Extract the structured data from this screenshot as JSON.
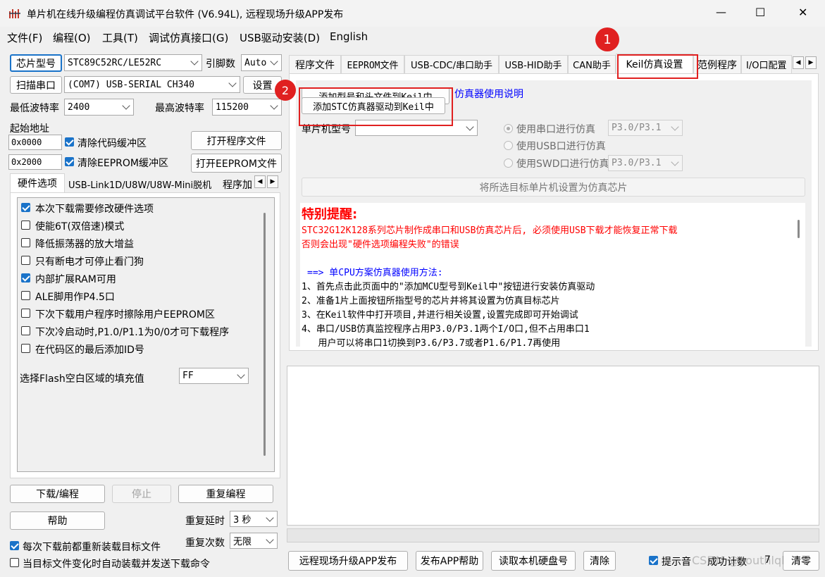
{
  "window": {
    "title": "单片机在线升级编程仿真调试平台软件 (V6.94L), 远程现场升级APP发布",
    "minimize": "—",
    "maximize": "☐",
    "close": "✕"
  },
  "menu": [
    "文件(F)",
    "编程(O)",
    "工具(T)",
    "调试仿真接口(G)",
    "USB驱动安装(D)",
    "English"
  ],
  "left": {
    "chip_button": "芯片型号",
    "chip_value": "STC89C52RC/LE52RC",
    "pin_label": "引脚数",
    "pin_value": "Auto",
    "scan_button": "扫描串口",
    "port_value": "(COM7) USB-SERIAL CH340",
    "settings_button": "设置",
    "min_baud_label": "最低波特率",
    "min_baud_value": "2400",
    "max_baud_label": "最高波特率",
    "max_baud_value": "115200",
    "start_addr_label": "起始地址",
    "addr1": "0x0000",
    "clear_code": "清除代码缓冲区",
    "open_prog": "打开程序文件",
    "addr2": "0x2000",
    "clear_eeprom": "清除EEPROM缓冲区",
    "open_eeprom": "打开EEPROM文件",
    "tabs": [
      "硬件选项",
      "USB-Link1D/U8W/U8W-Mini脱机",
      "程序加"
    ],
    "options": [
      {
        "label": "本次下载需要修改硬件选项",
        "checked": true
      },
      {
        "label": "使能6T(双倍速)模式",
        "checked": false
      },
      {
        "label": "降低振荡器的放大增益",
        "checked": false
      },
      {
        "label": "只有断电才可停止看门狗",
        "checked": false
      },
      {
        "label": "内部扩展RAM可用",
        "checked": true
      },
      {
        "label": "ALE脚用作P4.5口",
        "checked": false
      },
      {
        "label": "下次下载用户程序时擦除用户EEPROM区",
        "checked": false
      },
      {
        "label": "下次冷启动时,P1.0/P1.1为0/0才可下载程序",
        "checked": false
      },
      {
        "label": "在代码区的最后添加ID号",
        "checked": false
      }
    ],
    "fill_label": "选择Flash空白区域的填充值",
    "fill_value": "FF",
    "download_button": "下载/编程",
    "stop_button": "停止",
    "reprogram_button": "重复编程",
    "help_button": "帮助",
    "repeat_delay_label": "重复延时",
    "repeat_delay_value": "3 秒",
    "repeat_count_label": "重复次数",
    "repeat_count_value": "无限",
    "reload_each": "每次下载前都重新装载目标文件",
    "auto_reload": "当目标文件变化时自动装载并发送下载命令"
  },
  "right": {
    "tabs": [
      "程序文件",
      "EEPROM文件",
      "USB-CDC/串口助手",
      "USB-HID助手",
      "CAN助手",
      "Keil仿真设置",
      "范例程序",
      "I/O口配置"
    ],
    "add_model_button": "添加型号和头文件到Keil中",
    "add_driver_button": "添加STC仿真器驱动到Keil中",
    "emu_help_link": "仿真器使用说明",
    "mcu_model_label": "单片机型号",
    "mcu_model_value": "",
    "radio_serial": "使用串口进行仿真",
    "radio_usb": "使用USB口进行仿真",
    "radio_swd": "使用SWD口进行仿真",
    "serial_port_value": "P3.0/P3.1",
    "swd_port_value": "P3.0/P3.1",
    "set_target_button": "将所选目标单片机设置为仿真芯片",
    "notice_title": "特别提醒:",
    "notice_red1": "STC32G12K128系列芯片制作成串口和USB仿真芯片后, 必须使用USB下载才能恢复正常下载",
    "notice_red2": "否则会出现\"硬件选项编程失败\"的错误",
    "method_title": "==> 单CPU方案仿真器使用方法:",
    "steps": [
      "1、首先点击此页面中的\"添加MCU型号到Keil中\"按钮进行安装仿真驱动",
      "2、准备1片上面按钮所指型号的芯片并将其设置为仿真目标芯片",
      "3、在Keil软件中打开项目,并进行相关设置,设置完成即可开始调试",
      "4、串口/USB仿真监控程序占用P3.0/P3.1两个I/O口,但不占用串口1",
      "   用户可以将串口1切换到P3.6/P3.7或者P1.6/P1.7再使用"
    ],
    "publish_button": "远程现场升级APP发布",
    "publish_help_button": "发布APP帮助",
    "read_disk_button": "读取本机硬盘号",
    "clear_button": "清除",
    "beep_label": "提示音",
    "success_count_label": "成功计数",
    "success_count_value": "7",
    "reset_count_button": "清零"
  },
  "annotations": {
    "marker1": "1",
    "marker2": "2"
  },
  "watermark": "CSDN @youthlql",
  "colors": {
    "accent": "#1a73c9",
    "highlight": "#e02020",
    "notice_red": "#ff0000",
    "method_blue": "#0000ff"
  }
}
